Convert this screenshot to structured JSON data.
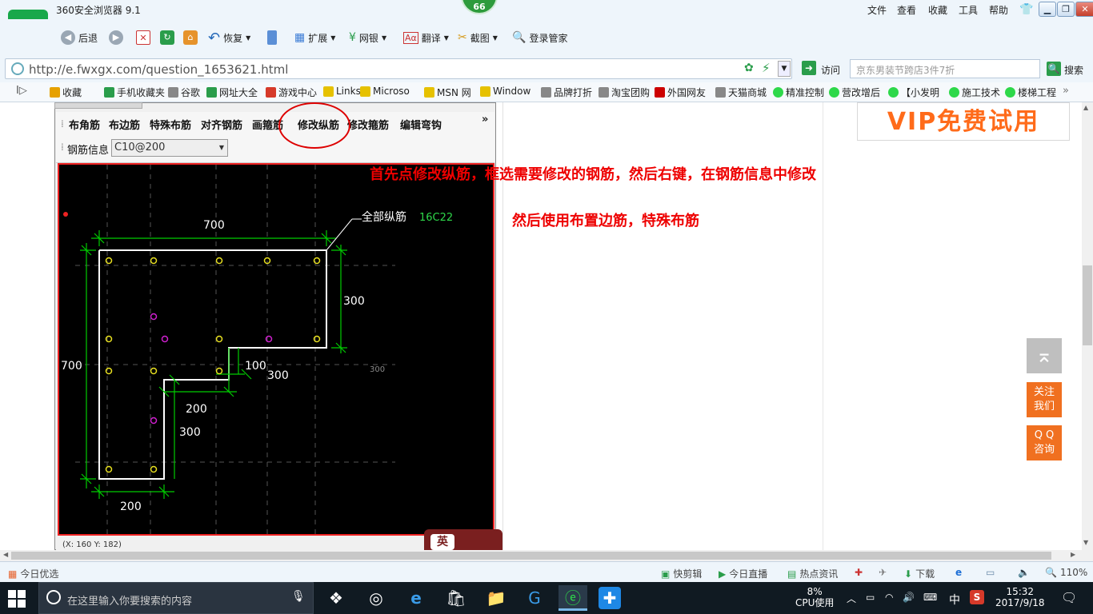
{
  "titlebar": {
    "title": "360安全浏览器 9.1",
    "badge": "66",
    "menu": [
      "文件",
      "查看",
      "收藏",
      "工具",
      "帮助"
    ]
  },
  "toolbar": {
    "back": "后退",
    "restore": "恢复",
    "extend": "扩展",
    "netbank": "网银",
    "translate": "翻译",
    "screenshot": "截图",
    "login": "登录管家"
  },
  "address": {
    "url": "http://e.fwxgx.com/question_1653621.html",
    "visit": "访问",
    "search_placeholder": "京东男装节跨店3件7折",
    "search": "搜索"
  },
  "favorites": [
    "收藏",
    "手机收藏夹",
    "谷歌",
    "网址大全",
    "游戏中心",
    "Links",
    "Microso",
    "MSN 网",
    "Window",
    "品牌打折",
    "淘宝团购",
    "外国网友",
    "天猫商城",
    "精准控制",
    "营改增后",
    "【小发明",
    "施工技术",
    "楼梯工程"
  ],
  "app": {
    "buttons": [
      "布角筋",
      "布边筋",
      "特殊布筋",
      "对齐钢筋",
      "画箍筋",
      "修改纵筋",
      "修改箍筋",
      "编辑弯钩"
    ],
    "rebar_info_label": "钢筋信息",
    "rebar_info_value": "C10@200",
    "status_text": "(X: 160 Y: 182)",
    "drawing": {
      "dims": {
        "top": "700",
        "left": "700",
        "right": "300",
        "mid_a": "100",
        "mid_b": "300",
        "ghost": "300",
        "low_a": "200",
        "low_b": "300",
        "bottom": "200"
      },
      "callout_label": "全部纵筋",
      "callout_value": "16C22"
    }
  },
  "annotations": {
    "line1": "首先点修改纵筋，框选需要修改的钢筋，然后右键，在钢筋信息中修改",
    "line2": "然后使用布置边筋，特殊布筋"
  },
  "vip": "VIP免费试用",
  "side": {
    "follow": "关注\n我们",
    "qq": "Q Q\n咨询"
  },
  "status": {
    "today": "今日优选",
    "clip": "快剪辑",
    "live": "今日直播",
    "news": "热点资讯",
    "download": "下载",
    "zoom": "110%"
  },
  "taskbar": {
    "search_placeholder": "在这里输入你要搜索的内容",
    "cpu": "8%",
    "cpu_label": "CPU使用",
    "ime": "中",
    "time": "15:32",
    "date": "2017/9/18"
  }
}
